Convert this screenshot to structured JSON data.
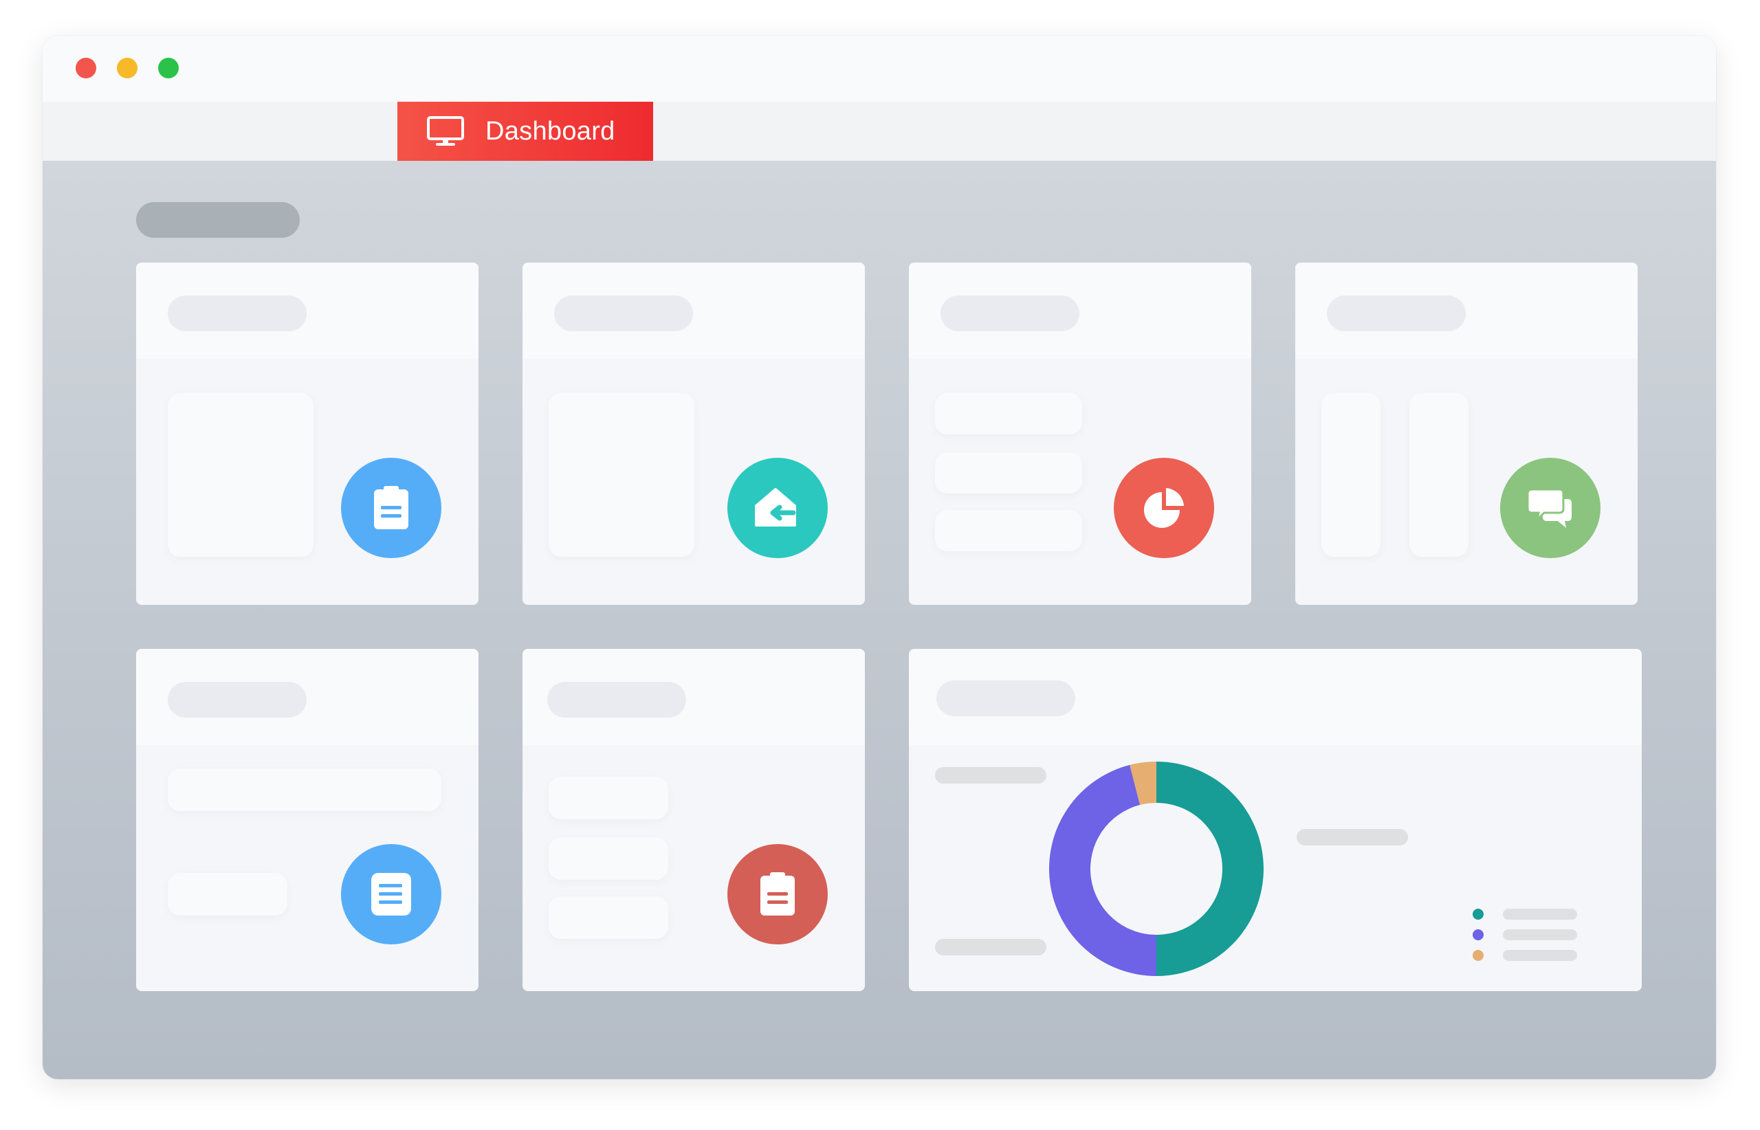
{
  "tab": {
    "label": "Dashboard",
    "icon": "monitor-icon"
  },
  "colors": {
    "tab": "#f0392f",
    "blue": "#55adf8",
    "teal": "#2bc8bf",
    "coral": "#ec5f52",
    "green": "#8bc47e",
    "red": "#d45f57",
    "window_red": "#f2554b",
    "window_yellow": "#f7b928",
    "window_green": "#2bc24a"
  },
  "cards": [
    {
      "icon": "clipboard-icon",
      "color": "#55adf8"
    },
    {
      "icon": "home-arrow-icon",
      "color": "#2bc8bf"
    },
    {
      "icon": "pie-chart-icon",
      "color": "#ec5f52"
    },
    {
      "icon": "chat-bubbles-icon",
      "color": "#8bc47e"
    },
    {
      "icon": "document-icon",
      "color": "#55adf8"
    },
    {
      "icon": "clipboard-icon",
      "color": "#d45f57"
    }
  ],
  "chart_data": {
    "type": "pie",
    "donut": true,
    "title": "",
    "series": [
      {
        "values": [
          50,
          46,
          4
        ],
        "colors": [
          "#179c96",
          "#6e62e6",
          "#e6ae70"
        ]
      }
    ],
    "legend_placement": "bottom-right"
  }
}
